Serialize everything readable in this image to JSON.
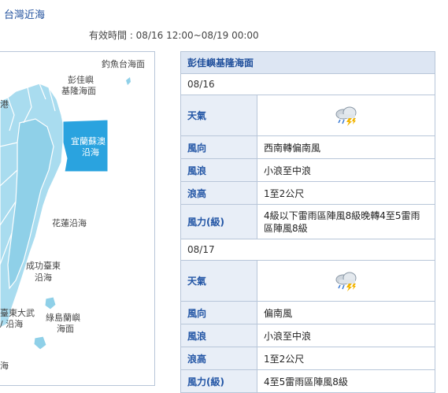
{
  "page": {
    "title": "台灣近海",
    "validity": "有效時間 : 08/16 12:00~08/19 00:00"
  },
  "map": {
    "labels": {
      "diaoyutai": "釣魚台海面",
      "pengjiayu_1": "彭佳嶼",
      "pengjiayu_2": "基隆海面",
      "port_partial": "港",
      "yilan_1": "宜蘭蘇澳",
      "yilan_2": "沿海",
      "hualien": "花蓮沿海",
      "chenggong_1": "成功臺東",
      "chenggong_2": "沿海",
      "taitung_1": "臺東大武",
      "taitung_2": "/ 沿海",
      "ludao_1": "綠島蘭嶼",
      "ludao_2": "海面",
      "sea_partial": "海"
    },
    "colors": {
      "land": "#a9dcef",
      "highlight": "#2aa3df",
      "stroke": "#ffffff"
    }
  },
  "forecast": {
    "area": "彭佳嶼基隆海面",
    "labels": {
      "weather": "天氣",
      "wind_dir": "風向",
      "wave": "風浪",
      "wave_height": "浪高",
      "wind_force": "風力(級)"
    },
    "days": [
      {
        "date": "08/16",
        "weather_icon": "thunderstorm-icon",
        "wind_dir": "西南轉偏南風",
        "wave": "小浪至中浪",
        "wave_height": "1至2公尺",
        "wind_force": "4級以下雷雨區陣風8級晚轉4至5雷雨區陣風8級"
      },
      {
        "date": "08/17",
        "weather_icon": "thunderstorm-icon",
        "wind_dir": "偏南風",
        "wave": "小浪至中浪",
        "wave_height": "1至2公尺",
        "wind_force": "4至5雷雨區陣風8級"
      }
    ]
  }
}
